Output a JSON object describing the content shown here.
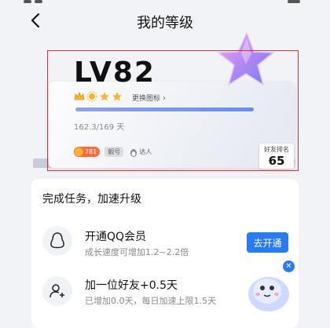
{
  "header": {
    "title": "我的等级"
  },
  "level_card": {
    "level": "LV82",
    "change_icon_label": "更换图标",
    "progress_text": "162.3/169 天",
    "progress_fraction": 0.96,
    "coin_badge": "781",
    "pretty_badge": "靓号",
    "expert_badge": "达人",
    "rank_label": "好友排名",
    "rank_value": "65"
  },
  "tasks": {
    "heading": "完成任务，加速升级",
    "items": [
      {
        "title": "开通QQ会员",
        "subtitle": "成长速度可增加1.2~2.2倍",
        "action": "去开通",
        "icon": "penguin-icon"
      },
      {
        "title": "加一位好友+0.5天",
        "subtitle": "已增加0.0天，每日加速上限1.5天",
        "icon": "add-friend-icon"
      }
    ]
  },
  "colors": {
    "accent": "#2a7bf0",
    "highlight_frame": "#e0302f",
    "page_bg": "#f2f3f7"
  }
}
